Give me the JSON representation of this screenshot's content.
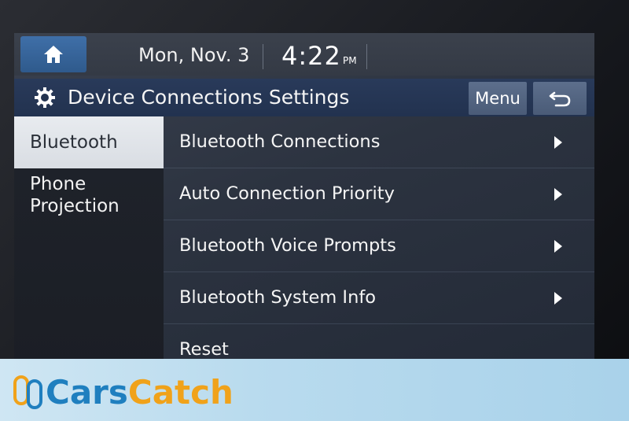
{
  "status_bar": {
    "date": "Mon, Nov. 3",
    "time": "4:22",
    "ampm": "PM",
    "home_icon": "home-icon"
  },
  "title_bar": {
    "title": "Device Connections Settings",
    "settings_icon": "gear-icon",
    "menu_label": "Menu",
    "back_icon": "back-arrow-icon"
  },
  "sidebar": {
    "items": [
      {
        "label": "Bluetooth",
        "active": true
      },
      {
        "label": "Phone\nProjection",
        "active": false
      }
    ]
  },
  "list": {
    "items": [
      {
        "label": "Bluetooth Connections",
        "has_arrow": true
      },
      {
        "label": "Auto Connection Priority",
        "has_arrow": true
      },
      {
        "label": "Bluetooth Voice Prompts",
        "has_arrow": true
      },
      {
        "label": "Bluetooth System Info",
        "has_arrow": true
      },
      {
        "label": "Reset",
        "has_arrow": false
      }
    ]
  },
  "watermark": {
    "part1": "Cars",
    "part2": "Catch",
    "color_cars": "#1f7fbf",
    "color_catch": "#f0a21a"
  },
  "colors": {
    "accent_home": "#2f5a8c",
    "titlebar": "#22324f",
    "active_item_bg": "#e0e3e8"
  }
}
